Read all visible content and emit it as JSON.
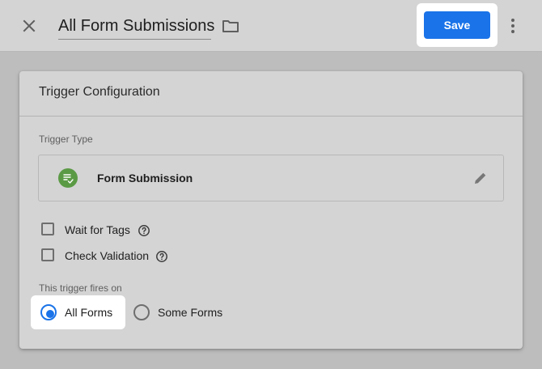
{
  "header": {
    "title": "All Form Submissions",
    "save_label": "Save",
    "icons": [
      "close-icon",
      "folder-icon",
      "more-vert-icon"
    ],
    "accent_color": "#1a73e8"
  },
  "card": {
    "title": "Trigger Configuration",
    "trigger_type_label": "Trigger Type",
    "trigger_type": {
      "name": "Form Submission",
      "icon": "form-submission-icon",
      "icon_color": "#5b9a45"
    },
    "options": [
      {
        "label": "Wait for Tags",
        "checked": false
      },
      {
        "label": "Check Validation",
        "checked": false
      }
    ],
    "fires_on_label": "This trigger fires on",
    "fires_on_options": [
      {
        "label": "All Forms",
        "selected": true
      },
      {
        "label": "Some Forms",
        "selected": false
      }
    ]
  }
}
